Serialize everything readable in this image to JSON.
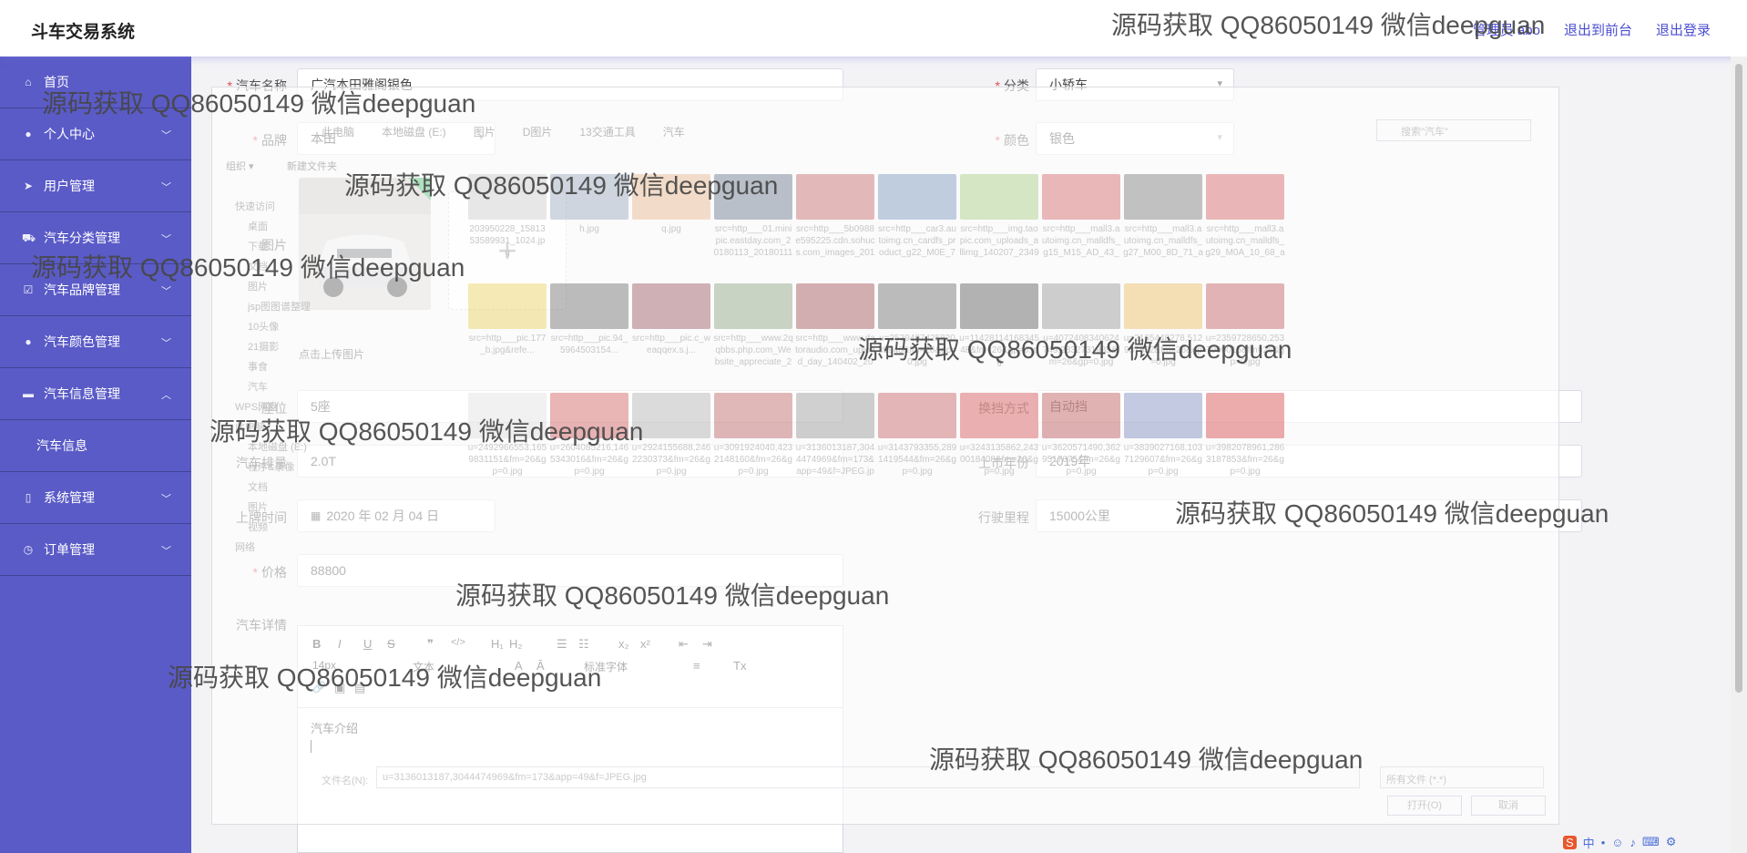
{
  "header": {
    "brand": "斗车交易系统",
    "links": [
      "管理员 abo",
      "退出到前台",
      "退出登录"
    ]
  },
  "sidebar": {
    "items": [
      {
        "label": "首页",
        "icon": "home-icon",
        "chevron": ""
      },
      {
        "label": "个人中心",
        "icon": "user-icon",
        "chevron": "﹀"
      },
      {
        "label": "用户管理",
        "icon": "send-icon",
        "chevron": "﹀"
      },
      {
        "label": "汽车分类管理",
        "icon": "car-icon",
        "chevron": "﹀"
      },
      {
        "label": "汽车品牌管理",
        "icon": "check-icon",
        "chevron": "﹀"
      },
      {
        "label": "汽车颜色管理",
        "icon": "user-icon",
        "chevron": "﹀"
      },
      {
        "label": "汽车信息管理",
        "icon": "chat-icon",
        "chevron": "︿"
      },
      {
        "label": "汽车信息",
        "icon": "",
        "chevron": "",
        "sub": true
      },
      {
        "label": "系统管理",
        "icon": "phone-icon",
        "chevron": "﹀"
      },
      {
        "label": "订单管理",
        "icon": "clock-icon",
        "chevron": "﹀"
      }
    ]
  },
  "form": {
    "car_name_label": "汽车名称",
    "car_name_value": "广汽本田雅阁银色",
    "category_label": "分类",
    "category_value": "小轿车",
    "brand_label": "品牌",
    "brand_value": "本田",
    "color_label": "颜色",
    "color_value": "银色",
    "image_label": "图片",
    "upload_tip": "点击上传图片",
    "seats_label": "座位",
    "seats_value": "5座",
    "gearbox_label": "换挡方式",
    "gearbox_value": "自动挡",
    "displacement_label": "汽车排量",
    "displacement_value": "2.0T",
    "year_label": "上市年份",
    "year_value": "2019年",
    "plate_date_label": "上牌时间",
    "plate_date_value": "2020 年 02 月 04 日",
    "mileage_label": "行驶里程",
    "mileage_value": "15000公里",
    "price_label": "价格",
    "price_value": "88800",
    "detail_label": "汽车详情",
    "editor_content": "汽车介绍"
  },
  "editor_toolbar": {
    "row1": [
      "B",
      "I",
      "U",
      "S",
      "❞",
      "</>",
      "H₁",
      "H₂",
      "☰",
      "☷",
      "x₂",
      "x²",
      "⇤",
      "⇥"
    ],
    "row2": [
      "14px",
      "文本",
      "A",
      "Ā",
      "标准字体",
      "≡",
      "Tx"
    ],
    "row3": [
      "🔗",
      "▣",
      "▤"
    ]
  },
  "dialog": {
    "path": [
      "此电脑",
      "本地磁盘 (E:)",
      "图片",
      "D图片",
      "13交通工具",
      "汽车"
    ],
    "search_placeholder": "搜索\"汽车\"",
    "organize": "组织 ▾",
    "new_folder": "新建文件夹",
    "tree": [
      "快速访问",
      "桌面",
      "下载",
      "文档",
      "图片",
      "jsp图图谱整理",
      "10头像",
      "21摄影",
      "事食",
      "汽车",
      "WPS网盘",
      "此电脑",
      "本地磁盘 (E:)",
      "程序&录像",
      "文档",
      "图片",
      "视频",
      "网络"
    ],
    "files": [
      {
        "name": "203950228_1581353589931_1024.jpg",
        "color": "#bcbcbc"
      },
      {
        "name": "h.jpg",
        "color": "#7b8fa8"
      },
      {
        "name": "q.jpg",
        "color": "#e3a46b"
      },
      {
        "name": "src=http___01.minipic.eastday.com_20180113_2018011131137...",
        "color": "#3f4f66"
      },
      {
        "name": "src=http___5b0988e595225.cdn.sohucs.com_images_20181...",
        "color": "#b63c3c"
      },
      {
        "name": "src=http___car3.autoimg.cn_cardfs_product_g22_M0E_75_64...",
        "color": "#4f77a8"
      },
      {
        "name": "src=http___img.taopic.com_uploads_allimg_140207_234973...",
        "color": "#8fc05b"
      },
      {
        "name": "src=http___mall3.autoimg.cn_malldfs_g15_M15_AD_43_autoh...",
        "color": "#c83a3a"
      },
      {
        "name": "src=http___mall3.autoimg.cn_malldfs_g27_M00_8D_71_autoh...",
        "color": "#555"
      },
      {
        "name": "src=http___mall3.autoimg.cn_malldfs_g29_M0A_10_68_autoh...",
        "color": "#c33"
      },
      {
        "name": "src=http___pic.177_b.jpg&refe...",
        "color": "#e5c62f"
      },
      {
        "name": "src=http___pic.94_5964503154...",
        "color": "#444"
      },
      {
        "name": "src=http___pic.c_weaqqex.s.j...",
        "color": "#7a2630"
      },
      {
        "name": "src=http___www.2qqbbs.php.com_Website_appreciate_201...",
        "color": "#6a8a5a"
      },
      {
        "name": "src=http___www.datoraudio.com_upload_day_140402_20140...",
        "color": "#8a1f22"
      },
      {
        "name": "u=353949742582039940&fm=26&gp=0.jpg",
        "color": "#444"
      },
      {
        "name": "u=1142811416834548&fm=26&gp=0.jpg",
        "color": "#2c2c2c"
      },
      {
        "name": "u=4072408340624749,2832731985&fm=26&gp=0.jpg",
        "color": "#777"
      },
      {
        "name": "u=2165448278,512937832&fm=26&gp=0.jpg",
        "color": "#e8a92f"
      },
      {
        "name": "u=2359728650,2537990015&fm=26&gp=0.jpg",
        "color": "#b32d2d"
      },
      {
        "name": "u=2492966553,1659831151&fm=26&gp=0.jpg",
        "color": "#d8d8d8"
      },
      {
        "name": "u=2604085216,1465343016&fm=26&gp=0.jpg",
        "color": "#c42a2a"
      },
      {
        "name": "u=2924155688,2462230373&fm=26&gp=0.jpg",
        "color": "#999"
      },
      {
        "name": "u=3091924040,4232148160&fm=26&gp=0.jpg",
        "color": "#a33"
      },
      {
        "name": "u=3136013187,3044474969&fm=173&app=49&f=JPEG.jpg",
        "color": "#777"
      },
      {
        "name": "u=3143793355,2891419544&fm=26&gp=0.jpg",
        "color": "#b33"
      },
      {
        "name": "u=3243135862,2430018408&fm=26&gp=0.jpg",
        "color": "#c22"
      },
      {
        "name": "u=3620571490,3629517675&fm=26&gp=0.jpg",
        "color": "#a22"
      },
      {
        "name": "u=3839027168,1037129607&fm=26&gp=0.jpg",
        "color": "#5566aa"
      },
      {
        "name": "u=3982078961,2863187853&fm=26&gp=0.jpg",
        "color": "#c11"
      }
    ],
    "filename_label": "文件名(N):",
    "filename_value": "u=3136013187,3044474969&fm=173&app=49&f=JPEG.jpg",
    "filetype": "所有文件 (*.*)",
    "open_button": "打开(O)",
    "cancel_button": "取消"
  },
  "watermark_text": "源码获取 QQ86050149 微信deepguan",
  "colors": {
    "sidebar_bg": "#5a5bc7",
    "accent": "#4b4ed0",
    "required": "#e24b4b"
  }
}
